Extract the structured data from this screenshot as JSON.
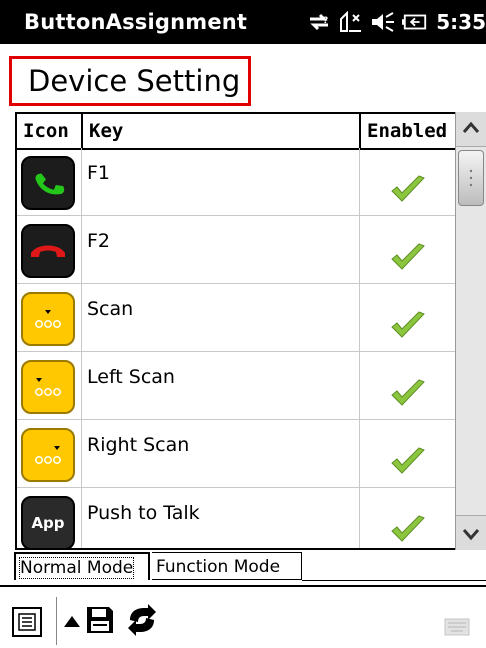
{
  "titlebar": {
    "app_title": "ButtonAssignment",
    "time": "5:35"
  },
  "status_icons": [
    "connectivity-icon",
    "signal-icon",
    "volume-icon",
    "battery-icon"
  ],
  "page": {
    "heading": "Device Setting"
  },
  "table": {
    "headers": {
      "icon": "Icon",
      "key": "Key",
      "enabled": "Enabled"
    },
    "rows": [
      {
        "icon": "phone-green-icon",
        "key": "F1",
        "enabled": true
      },
      {
        "icon": "phone-red-icon",
        "key": "F2",
        "enabled": true
      },
      {
        "icon": "scan-icon",
        "key": "Scan",
        "enabled": true
      },
      {
        "icon": "left-scan-icon",
        "key": "Left Scan",
        "enabled": true
      },
      {
        "icon": "right-scan-icon",
        "key": "Right Scan",
        "enabled": true
      },
      {
        "icon": "app-icon",
        "key": "Push to Talk",
        "icon_text": "App",
        "enabled": true
      }
    ]
  },
  "tabs": {
    "normal": "Normal Mode",
    "function": "Function Mode",
    "selected": "normal"
  },
  "colors": {
    "accent_red": "#e00000",
    "scan_yellow": "#ffc800",
    "check_green": "#8cc63f"
  }
}
